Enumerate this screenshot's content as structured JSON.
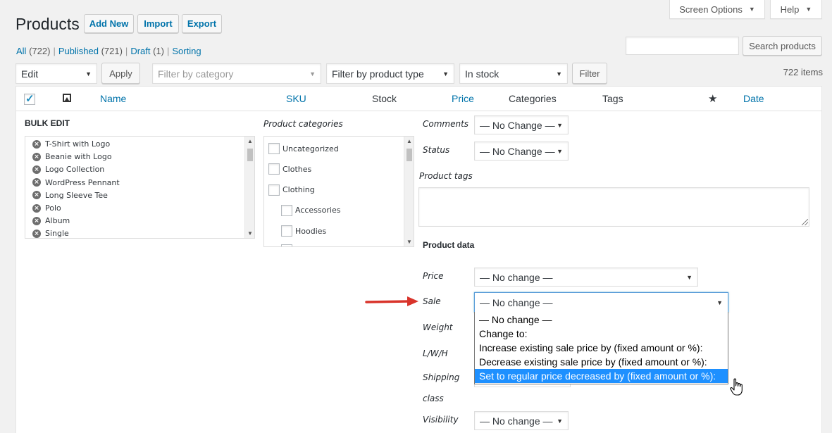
{
  "page_title": "Products",
  "header_buttons": {
    "add_new": "Add New",
    "import": "Import",
    "export": "Export"
  },
  "top_tabs": {
    "screen_options": "Screen Options",
    "help": "Help"
  },
  "subsubsub": {
    "all": "All",
    "all_count": "(722)",
    "published": "Published",
    "published_count": "(721)",
    "draft": "Draft",
    "draft_count": "(1)",
    "sorting": "Sorting"
  },
  "search": {
    "value": "",
    "button": "Search products"
  },
  "tablenav": {
    "bulk_action": "Edit",
    "apply": "Apply",
    "filter_category_placeholder": "Filter by category",
    "filter_product_type": "Filter by product type",
    "stock_status": "In stock",
    "filter_button": "Filter",
    "items_count": "722 items"
  },
  "columns": {
    "name": "Name",
    "sku": "SKU",
    "stock": "Stock",
    "price": "Price",
    "categories": "Categories",
    "tags": "Tags",
    "date": "Date"
  },
  "bulk_edit": {
    "title": "BULK EDIT",
    "products": [
      "T-Shirt with Logo",
      "Beanie with Logo",
      "Logo Collection",
      "WordPress Pennant",
      "Long Sleeve Tee",
      "Polo",
      "Album",
      "Single"
    ],
    "categories_label": "Product categories",
    "categories": [
      "Uncategorized",
      "Clothes",
      "Clothing",
      "Accessories",
      "Hoodies"
    ],
    "comments_label": "Comments",
    "comments_value": "— No Change —",
    "status_label": "Status",
    "status_value": "— No Change —",
    "tags_label": "Product tags",
    "tags_value": "",
    "product_data_label": "Product data",
    "price_label": "Price",
    "price_value": "— No change —",
    "sale_label": "Sale",
    "sale_value": "— No change —",
    "weight_label": "Weight",
    "lwh_label": "L/W/H",
    "shipping_label": "Shipping",
    "class_label": "class",
    "visibility_label": "Visibility",
    "visibility_value": "— No change —"
  },
  "sale_dropdown_options": [
    "— No change —",
    "Change to:",
    "Increase existing sale price by (fixed amount or %):",
    "Decrease existing sale price by (fixed amount or %):",
    "Set to regular price decreased by (fixed amount or %):"
  ],
  "colors": {
    "link": "#0073aa",
    "selected_option": "#1e90ff",
    "arrow": "#d9342b"
  }
}
